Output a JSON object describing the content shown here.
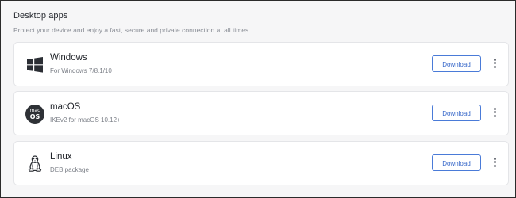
{
  "section": {
    "title": "Desktop apps",
    "subtitle": "Protect your device and enjoy a fast, secure and private connection at all times."
  },
  "apps": [
    {
      "name": "Windows",
      "description": "For Windows 7/8.1/10",
      "download_label": "Download",
      "icon": "windows-icon"
    },
    {
      "name": "macOS",
      "description": "IKEv2 for macOS 10.12+",
      "download_label": "Download",
      "icon": "macos-icon",
      "badge_top": "mac",
      "badge_bottom": "OS"
    },
    {
      "name": "Linux",
      "description": "DEB package",
      "download_label": "Download",
      "icon": "linux-tux-icon"
    }
  ],
  "colors": {
    "accent": "#3566c9",
    "background": "#f6f6f7",
    "card": "#ffffff"
  }
}
